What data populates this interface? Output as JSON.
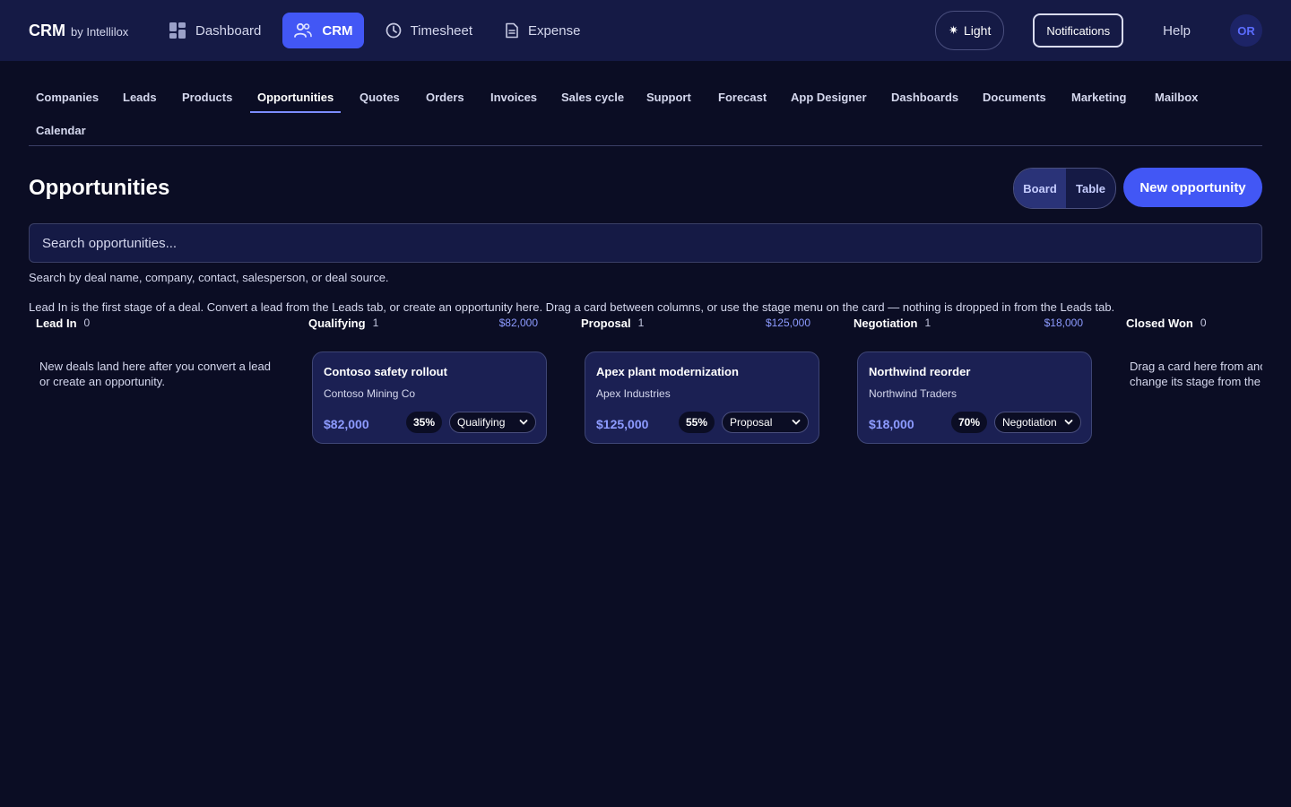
{
  "brand": {
    "name": "CRM",
    "by": "by Intellilox"
  },
  "appnav": [
    {
      "label": "Dashboard",
      "icon": "dashboard-icon"
    },
    {
      "label": "CRM",
      "icon": "users-icon"
    },
    {
      "label": "Timesheet",
      "icon": "clock-icon"
    },
    {
      "label": "Expense",
      "icon": "document-icon"
    }
  ],
  "topright": {
    "theme_label": "Light",
    "notifications_label": "Notifications",
    "help_label": "Help",
    "avatar_initials": "OR"
  },
  "modtabs": [
    "Companies",
    "Leads",
    "Products",
    "Opportunities",
    "Quotes",
    "Orders",
    "Invoices",
    "Sales cycle",
    "Support",
    "Forecast",
    "App Designer",
    "Dashboards",
    "Documents",
    "Marketing",
    "Mailbox",
    "Calendar"
  ],
  "active_modtab": "Opportunities",
  "page": {
    "title": "Opportunities",
    "view_board": "Board",
    "view_table": "Table",
    "new_button": "New opportunity",
    "search_placeholder": "Search opportunities...",
    "hint_search": "Search by deal name, company, contact, salesperson, or deal source.",
    "hint_board": "Lead In is the first stage of a deal. Convert a lead from the Leads tab, or create an opportunity here. Drag a card between columns, or use the stage menu on the card — nothing is dropped in from the Leads tab."
  },
  "columns": [
    {
      "name": "Lead In",
      "count": "0",
      "sum": "",
      "empty_text": "New deals land here after you convert a lead or create an opportunity."
    },
    {
      "name": "Qualifying",
      "count": "1",
      "sum": "$82,000",
      "card": {
        "title": "Contoso safety rollout",
        "company": "Contoso Mining Co",
        "amount": "$82,000",
        "probability": "35%",
        "stage": "Qualifying"
      }
    },
    {
      "name": "Proposal",
      "count": "1",
      "sum": "$125,000",
      "card": {
        "title": "Apex plant modernization",
        "company": "Apex Industries",
        "amount": "$125,000",
        "probability": "55%",
        "stage": "Proposal"
      }
    },
    {
      "name": "Negotiation",
      "count": "1",
      "sum": "$18,000",
      "card": {
        "title": "Northwind reorder",
        "company": "Northwind Traders",
        "amount": "$18,000",
        "probability": "70%",
        "stage": "Negotiation"
      }
    },
    {
      "name": "Closed Won",
      "count": "0",
      "sum": "",
      "empty_text": "Drag a card here from another column, or change its stage from the card."
    }
  ]
}
